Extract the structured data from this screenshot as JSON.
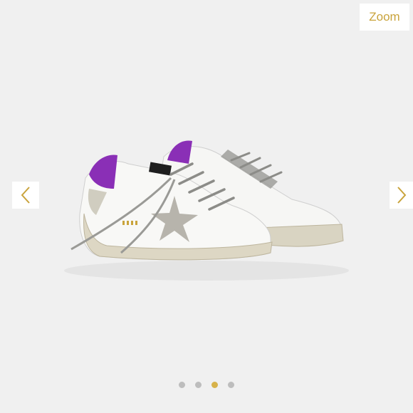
{
  "toolbar": {
    "zoom_label": "Zoom"
  },
  "gallery": {
    "active_index": 2,
    "slide_count": 4,
    "image_subject": "sneakers"
  },
  "colors": {
    "accent": "#c9a33b",
    "dot_inactive": "#bdbdbd",
    "dot_active": "#d7b24a",
    "background": "#f0f0f0"
  },
  "icons": {
    "prev": "chevron-left-icon",
    "next": "chevron-right-icon"
  }
}
